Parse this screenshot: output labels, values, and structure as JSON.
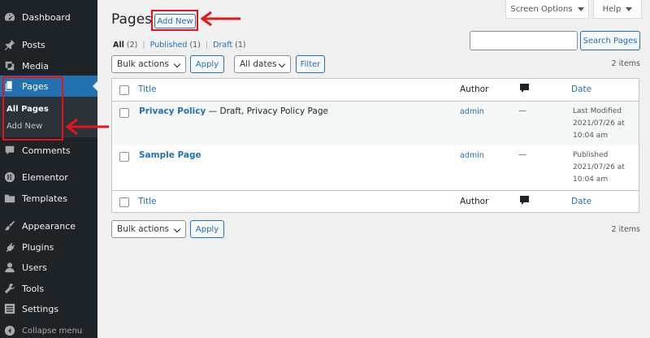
{
  "sidebar": {
    "items": [
      {
        "label": "Dashboard",
        "icon": "dashboard-icon"
      },
      {
        "label": "Posts",
        "icon": "pin-icon"
      },
      {
        "label": "Media",
        "icon": "media-icon"
      },
      {
        "label": "Pages",
        "icon": "pages-icon",
        "active": true
      },
      {
        "label": "Comments",
        "icon": "comment-icon"
      },
      {
        "label": "Elementor",
        "icon": "elementor-icon"
      },
      {
        "label": "Templates",
        "icon": "folder-icon"
      },
      {
        "label": "Appearance",
        "icon": "brush-icon"
      },
      {
        "label": "Plugins",
        "icon": "plug-icon"
      },
      {
        "label": "Users",
        "icon": "user-icon"
      },
      {
        "label": "Tools",
        "icon": "wrench-icon"
      },
      {
        "label": "Settings",
        "icon": "settings-icon"
      }
    ],
    "submenu": [
      "All Pages",
      "Add New"
    ],
    "collapse_label": "Collapse menu"
  },
  "header": {
    "title": "Pages",
    "add_new_label": "Add New",
    "screen_options_label": "Screen Options",
    "help_label": "Help"
  },
  "views": {
    "all_label": "All",
    "all_count": "(2)",
    "published_label": "Published",
    "published_count": "(1)",
    "draft_label": "Draft",
    "draft_count": "(1)"
  },
  "search": {
    "button_label": "Search Pages",
    "value": ""
  },
  "toolbar": {
    "bulk_actions": "Bulk actions",
    "apply": "Apply",
    "all_dates": "All dates",
    "filter": "Filter",
    "items_count": "2 items"
  },
  "table": {
    "columns": {
      "title": "Title",
      "author": "Author",
      "date": "Date"
    },
    "rows": [
      {
        "title": "Privacy Policy",
        "state": " — Draft, Privacy Policy Page",
        "author": "admin",
        "comments": "—",
        "date_status": "Last Modified",
        "date_value": "2021/07/26 at",
        "date_time": "10:04 am"
      },
      {
        "title": "Sample Page",
        "state": "",
        "author": "admin",
        "comments": "—",
        "date_status": "Published",
        "date_value": "2021/07/26 at",
        "date_time": "10:04 am"
      }
    ]
  },
  "colors": {
    "sidebar_bg": "#1d2327",
    "accent": "#2271b1",
    "annotation_red": "#e3151a"
  }
}
